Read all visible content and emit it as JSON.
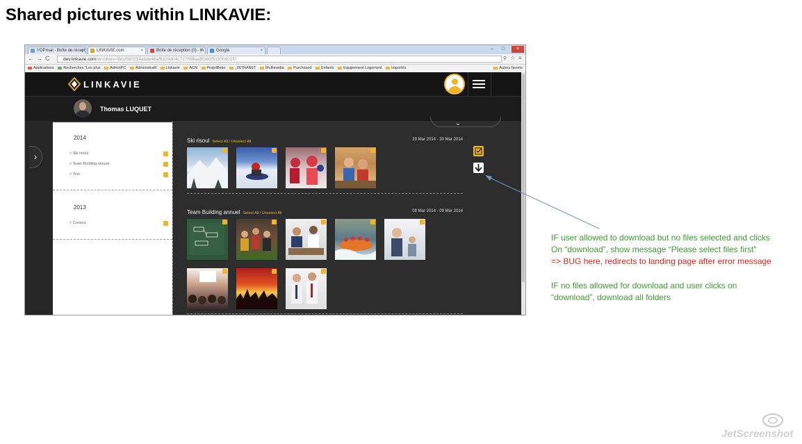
{
  "document": {
    "title": "Shared pictures within LINKAVIE:"
  },
  "browser": {
    "tabs": [
      {
        "label": "YOPmail - Boîte de récept",
        "active": false
      },
      {
        "label": "LINKAVIE.com",
        "active": true
      },
      {
        "label": "Boîte de réception (0) - th",
        "active": false
      },
      {
        "label": "Google",
        "active": false
      }
    ],
    "url_host": "dev.linkavie.com",
    "url_path": "/en/share-files/580214abde46af8224d04c727f9f8aa5f383f51500d21f0",
    "bookmarks": [
      "Applications",
      "Recherches \"Les plus",
      "AdminPC",
      "Administratif",
      "Linkavie",
      "ACN",
      "ProjetBeko",
      "_INTRANET",
      "Multimedia",
      "Purchased",
      "Enfants",
      "Equipement Logement",
      "Importés"
    ],
    "bookmarks_right": "Autres favoris"
  },
  "site": {
    "brand": "LINKAVIE",
    "user_name": "Thomas LUQUET"
  },
  "sidebar": {
    "groups": [
      {
        "year": "2014",
        "items": [
          "Ski risoul",
          "Team Building annuel",
          "Test"
        ]
      },
      {
        "year": "2013",
        "items": [
          "Corsica"
        ]
      }
    ]
  },
  "albums": [
    {
      "name": "Ski risoul",
      "select_all": "Select All",
      "sep": "/",
      "unselect_all": "Unselect All",
      "dates": "29 Mar 2014 - 30 Mar 2014",
      "photos": [
        "snowy-mountain",
        "sledding-child",
        "kids-skiing",
        "children-sofa"
      ]
    },
    {
      "name": "Team Building annuel",
      "select_all": "Select All",
      "sep": "/",
      "unselect_all": "Unselect All",
      "dates": "08 Mar 2014 - 09 Mar 2014",
      "photos": [
        "chalkboard",
        "cheering-team",
        "meeting-table",
        "rafting",
        "applauding-woman",
        "conference-audience",
        "concert-crowd",
        "business-people"
      ]
    }
  ],
  "actions": {
    "select_icon": "check-icon",
    "download_icon": "download-arrow-icon"
  },
  "notes": {
    "green_lines": [
      "IF user allowed to download but no files selected and clicks",
      "On “download”, show message “Please select files first”"
    ],
    "red_line": "=> BUG here, redirects to landing page after error message",
    "green_lines_2": [
      "IF no files allowed for download and user clicks on",
      "“download”, download all folders"
    ]
  },
  "colors": {
    "accent": "#f0b429",
    "note_green": "#3c9d2f",
    "note_red": "#e0271b",
    "arrow": "#6f95c8"
  },
  "watermark": "JetScreenshot"
}
